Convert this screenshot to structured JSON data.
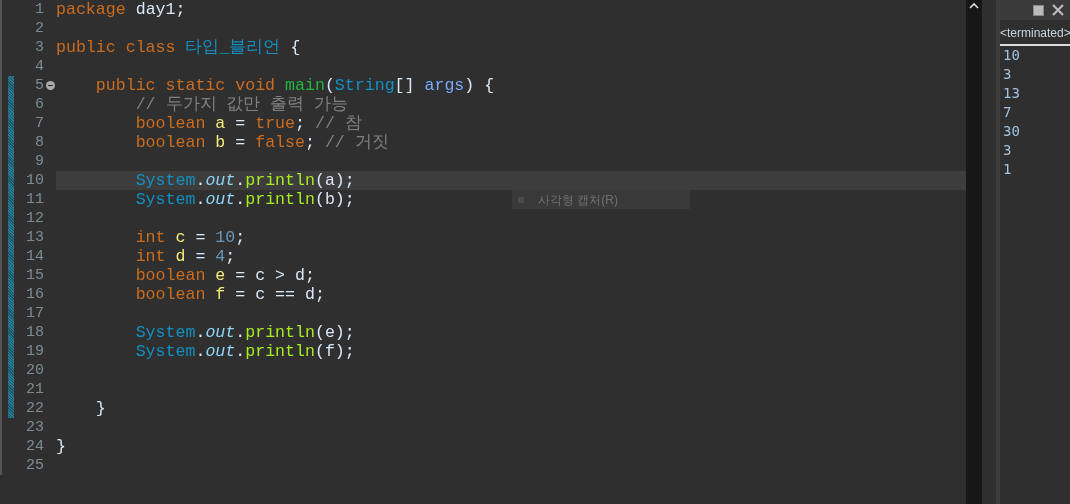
{
  "editor": {
    "lines": [
      {
        "number": "1",
        "current": false,
        "changed": false,
        "tokens": [
          {
            "kind": "keyword",
            "text": "package"
          },
          {
            "kind": "plain",
            "text": " day1;"
          }
        ]
      },
      {
        "number": "2",
        "current": false,
        "changed": false
      },
      {
        "number": "3",
        "current": false,
        "changed": false,
        "tokens": [
          {
            "kind": "keyword",
            "text": "public class "
          },
          {
            "kind": "class",
            "text": "타입_블리언"
          },
          {
            "kind": "plain",
            "text": " {"
          }
        ],
        "children": [
          {
            "number": "4",
            "current": false,
            "changed": false
          },
          {
            "number": "5",
            "current": false,
            "changed": true,
            "fold": true,
            "tokens": [
              {
                "kind": "keyword",
                "text": "public static void "
              },
              {
                "kind": "method",
                "text": "main"
              },
              {
                "kind": "plain",
                "text": "("
              },
              {
                "kind": "class",
                "text": "String"
              },
              {
                "kind": "plain",
                "text": "[] "
              },
              {
                "kind": "param",
                "text": "args"
              },
              {
                "kind": "plain",
                "text": ") {"
              }
            ],
            "children": [
              {
                "number": "6",
                "current": false,
                "changed": true,
                "tokens": [
                  {
                    "kind": "comment",
                    "text": "// 두가지 값만 출력 가능"
                  }
                ]
              },
              {
                "number": "7",
                "current": false,
                "changed": true,
                "tokens": [
                  {
                    "kind": "keyword",
                    "text": "boolean "
                  },
                  {
                    "kind": "variable",
                    "text": "a"
                  },
                  {
                    "kind": "plain",
                    "text": " = "
                  },
                  {
                    "kind": "keyword",
                    "text": "true"
                  },
                  {
                    "kind": "plain",
                    "text": "; "
                  },
                  {
                    "kind": "comment",
                    "text": "// 참"
                  }
                ]
              },
              {
                "number": "8",
                "current": false,
                "changed": true,
                "tokens": [
                  {
                    "kind": "keyword",
                    "text": "boolean "
                  },
                  {
                    "kind": "variable",
                    "text": "b"
                  },
                  {
                    "kind": "plain",
                    "text": " = "
                  },
                  {
                    "kind": "keyword",
                    "text": "false"
                  },
                  {
                    "kind": "plain",
                    "text": "; "
                  },
                  {
                    "kind": "comment",
                    "text": "// 거짓"
                  }
                ]
              },
              {
                "number": "9",
                "current": false,
                "changed": true
              },
              {
                "number": "10",
                "current": true,
                "changed": true,
                "tokens": [
                  {
                    "kind": "class",
                    "text": "System"
                  },
                  {
                    "kind": "plain",
                    "text": "."
                  },
                  {
                    "kind": "field",
                    "text": "out"
                  },
                  {
                    "kind": "plain",
                    "text": "."
                  },
                  {
                    "kind": "call",
                    "text": "println"
                  },
                  {
                    "kind": "plain",
                    "text": "(a);"
                  }
                ]
              },
              {
                "number": "11",
                "current": false,
                "changed": true,
                "tokens": [
                  {
                    "kind": "class",
                    "text": "System"
                  },
                  {
                    "kind": "plain",
                    "text": "."
                  },
                  {
                    "kind": "field",
                    "text": "out"
                  },
                  {
                    "kind": "plain",
                    "text": "."
                  },
                  {
                    "kind": "call",
                    "text": "println"
                  },
                  {
                    "kind": "plain",
                    "text": "(b);"
                  }
                ]
              },
              {
                "number": "12",
                "current": false,
                "changed": true
              },
              {
                "number": "13",
                "current": false,
                "changed": true,
                "tokens": [
                  {
                    "kind": "keyword",
                    "text": "int "
                  },
                  {
                    "kind": "variable",
                    "text": "c"
                  },
                  {
                    "kind": "plain",
                    "text": " = "
                  },
                  {
                    "kind": "number",
                    "text": "10"
                  },
                  {
                    "kind": "plain",
                    "text": ";"
                  }
                ]
              },
              {
                "number": "14",
                "current": false,
                "changed": true,
                "tokens": [
                  {
                    "kind": "keyword",
                    "text": "int "
                  },
                  {
                    "kind": "variable",
                    "text": "d"
                  },
                  {
                    "kind": "plain",
                    "text": " = "
                  },
                  {
                    "kind": "number",
                    "text": "4"
                  },
                  {
                    "kind": "plain",
                    "text": ";"
                  }
                ]
              },
              {
                "number": "15",
                "current": false,
                "changed": true,
                "tokens": [
                  {
                    "kind": "keyword",
                    "text": "boolean "
                  },
                  {
                    "kind": "variable",
                    "text": "e"
                  },
                  {
                    "kind": "plain",
                    "text": " = c > d;"
                  }
                ]
              },
              {
                "number": "16",
                "current": false,
                "changed": true,
                "tokens": [
                  {
                    "kind": "keyword",
                    "text": "boolean "
                  },
                  {
                    "kind": "variable",
                    "text": "f"
                  },
                  {
                    "kind": "plain",
                    "text": " = c == d;"
                  }
                ]
              },
              {
                "number": "17",
                "current": false,
                "changed": true
              },
              {
                "number": "18",
                "current": false,
                "changed": true,
                "tokens": [
                  {
                    "kind": "class",
                    "text": "System"
                  },
                  {
                    "kind": "plain",
                    "text": "."
                  },
                  {
                    "kind": "field",
                    "text": "out"
                  },
                  {
                    "kind": "plain",
                    "text": "."
                  },
                  {
                    "kind": "call",
                    "text": "println"
                  },
                  {
                    "kind": "plain",
                    "text": "(e);"
                  }
                ]
              },
              {
                "number": "19",
                "current": false,
                "changed": true,
                "tokens": [
                  {
                    "kind": "class",
                    "text": "System"
                  },
                  {
                    "kind": "plain",
                    "text": "."
                  },
                  {
                    "kind": "field",
                    "text": "out"
                  },
                  {
                    "kind": "plain",
                    "text": "."
                  },
                  {
                    "kind": "call",
                    "text": "println"
                  },
                  {
                    "kind": "plain",
                    "text": "(f);"
                  }
                ]
              },
              {
                "number": "20",
                "current": false,
                "changed": true
              },
              {
                "number": "21",
                "current": false,
                "changed": true
              }
            ]
          },
          {
            "number": "22",
            "current": false,
            "changed": true,
            "tokens": [
              {
                "kind": "plain",
                "text": "}"
              }
            ]
          },
          {
            "number": "23",
            "current": false,
            "changed": false
          }
        ]
      },
      {
        "number": "24",
        "current": false,
        "changed": false,
        "tokens": [
          {
            "kind": "plain",
            "text": "}"
          }
        ]
      },
      {
        "number": "25",
        "current": false,
        "changed": false
      }
    ]
  },
  "overlay_menu": {
    "label": "사각형 캡처(R)"
  },
  "console": {
    "status": "<terminated>",
    "output": [
      "10",
      "3",
      "13",
      "7",
      "30",
      "3",
      "1"
    ]
  }
}
